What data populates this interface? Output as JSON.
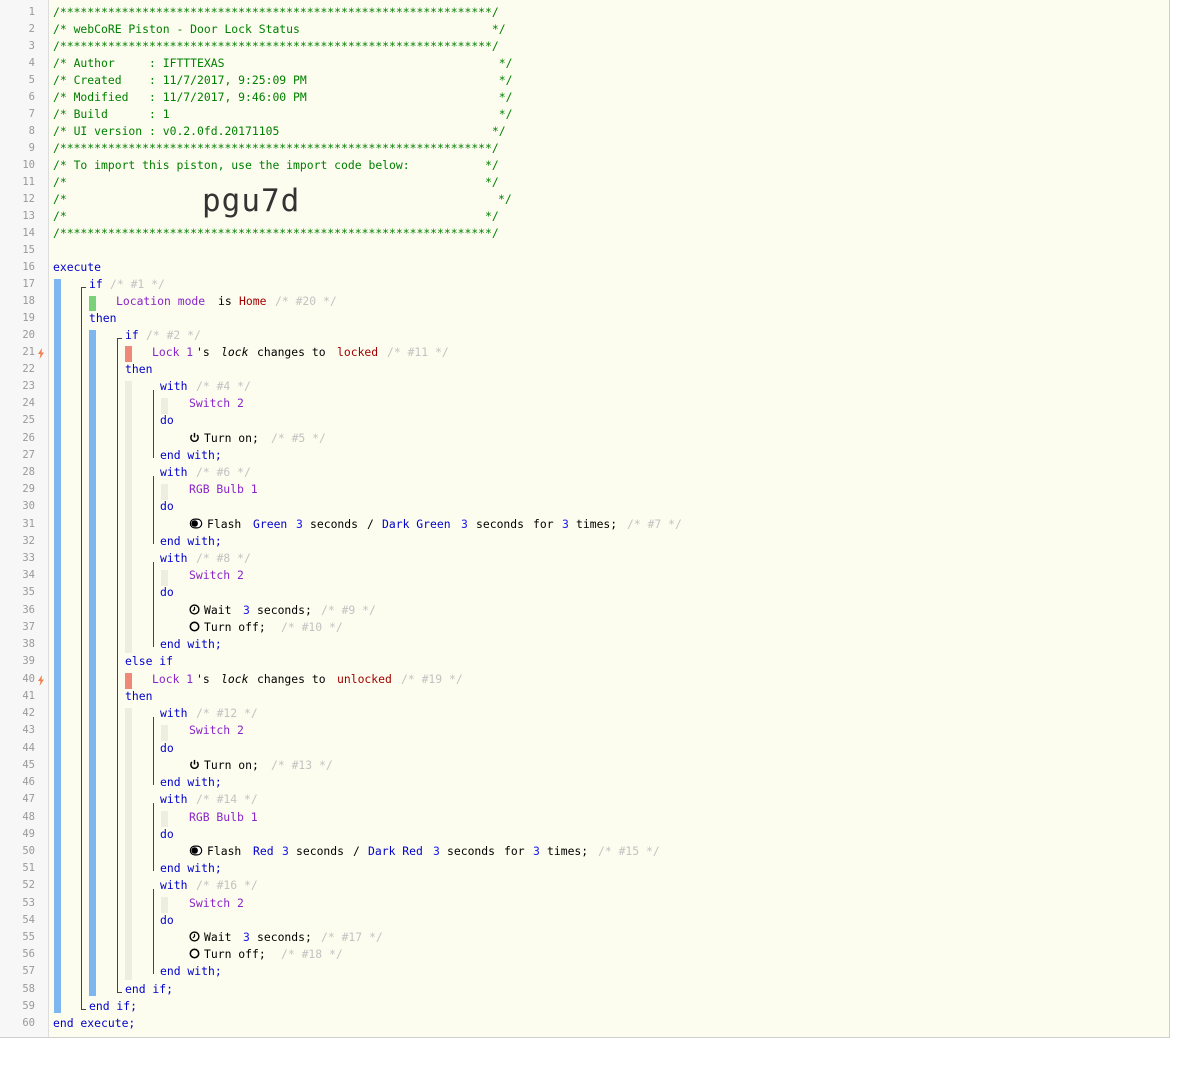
{
  "header": {
    "border": "/***************************************************************/",
    "title_line": "/* webCoRE Piston - Door Lock Status                            */",
    "author_line": "/* Author     : IFTTTEXAS                                        */",
    "created_line": "/* Created    : 11/7/2017, 9:25:09 PM                            */",
    "modified_line": "/* Modified   : 11/7/2017, 9:46:00 PM                            */",
    "build_line": "/* Build      : 1                                                */",
    "ui_line": "/* UI version : v0.2.0fd.20171105                               */",
    "import_line": "/* To import this piston, use the import code below:           */",
    "blank_line": "/*                                                             */",
    "code_prefix": "/*",
    "code_suffix": "*/",
    "import_code": "pgu7d"
  },
  "keywords": {
    "execute": "execute",
    "end_execute": "end execute;",
    "if": "if",
    "then": "then",
    "else_if": "else if",
    "end_if": "end if;",
    "with": "with",
    "do": "do",
    "end_with": "end with;"
  },
  "comments": {
    "c1": "/* #1 */",
    "c2": "/* #2 */",
    "c4": "/* #4 */",
    "c5": "/* #5 */",
    "c6": "/* #6 */",
    "c7": "/* #7 */",
    "c8": "/* #8 */",
    "c9": "/* #9 */",
    "c10": "/* #10 */",
    "c11": "/* #11 */",
    "c12": "/* #12 */",
    "c13": "/* #13 */",
    "c14": "/* #14 */",
    "c15": "/* #15 */",
    "c16": "/* #16 */",
    "c17": "/* #17 */",
    "c18": "/* #18 */",
    "c19": "/* #19 */",
    "c20": "/* #20 */"
  },
  "conditions": {
    "location": {
      "subject": "Location mode",
      "op": "is",
      "value": "Home"
    },
    "locked": {
      "device": "Lock 1",
      "poss": "'s",
      "attr": "lock",
      "op": "changes to",
      "value": "locked"
    },
    "unlocked": {
      "device": "Lock 1",
      "poss": "'s",
      "attr": "lock",
      "op": "changes to",
      "value": "unlocked"
    }
  },
  "devices": {
    "switch": "Switch 2",
    "bulb": "RGB Bulb 1"
  },
  "actions": {
    "turn_on": "Turn on;",
    "turn_off": "Turn off;",
    "flash": "Flash",
    "wait": "Wait",
    "seconds": "seconds",
    "seconds_semi": "seconds;",
    "slash": "/",
    "for": "for",
    "times": "times;",
    "three": "3",
    "green": "Green",
    "dark_green": "Dark Green",
    "red": "Red",
    "dark_red": "Dark Red"
  },
  "line_numbers": [
    "1",
    "2",
    "3",
    "4",
    "5",
    "6",
    "7",
    "8",
    "9",
    "10",
    "11",
    "12",
    "13",
    "14",
    "15",
    "16",
    "17",
    "18",
    "19",
    "20",
    "21",
    "22",
    "23",
    "24",
    "25",
    "26",
    "27",
    "28",
    "29",
    "30",
    "31",
    "32",
    "33",
    "34",
    "35",
    "36",
    "37",
    "38",
    "39",
    "40",
    "41",
    "42",
    "43",
    "44",
    "45",
    "46",
    "47",
    "48",
    "49",
    "50",
    "51",
    "52",
    "53",
    "54",
    "55",
    "56",
    "57",
    "58",
    "59",
    "60"
  ],
  "icons": {
    "power": "power-icon",
    "flash": "toggle-icon",
    "wait": "clock-icon",
    "off": "circle-icon",
    "trigger": "lightning-icon"
  },
  "colors": {
    "keyword": "#0000cc",
    "device": "#8b24c9",
    "value": "#a00000",
    "header": "#008000",
    "bar_blue": "#7eb6f0",
    "bar_green": "#79d279",
    "bar_red": "#f08878"
  }
}
